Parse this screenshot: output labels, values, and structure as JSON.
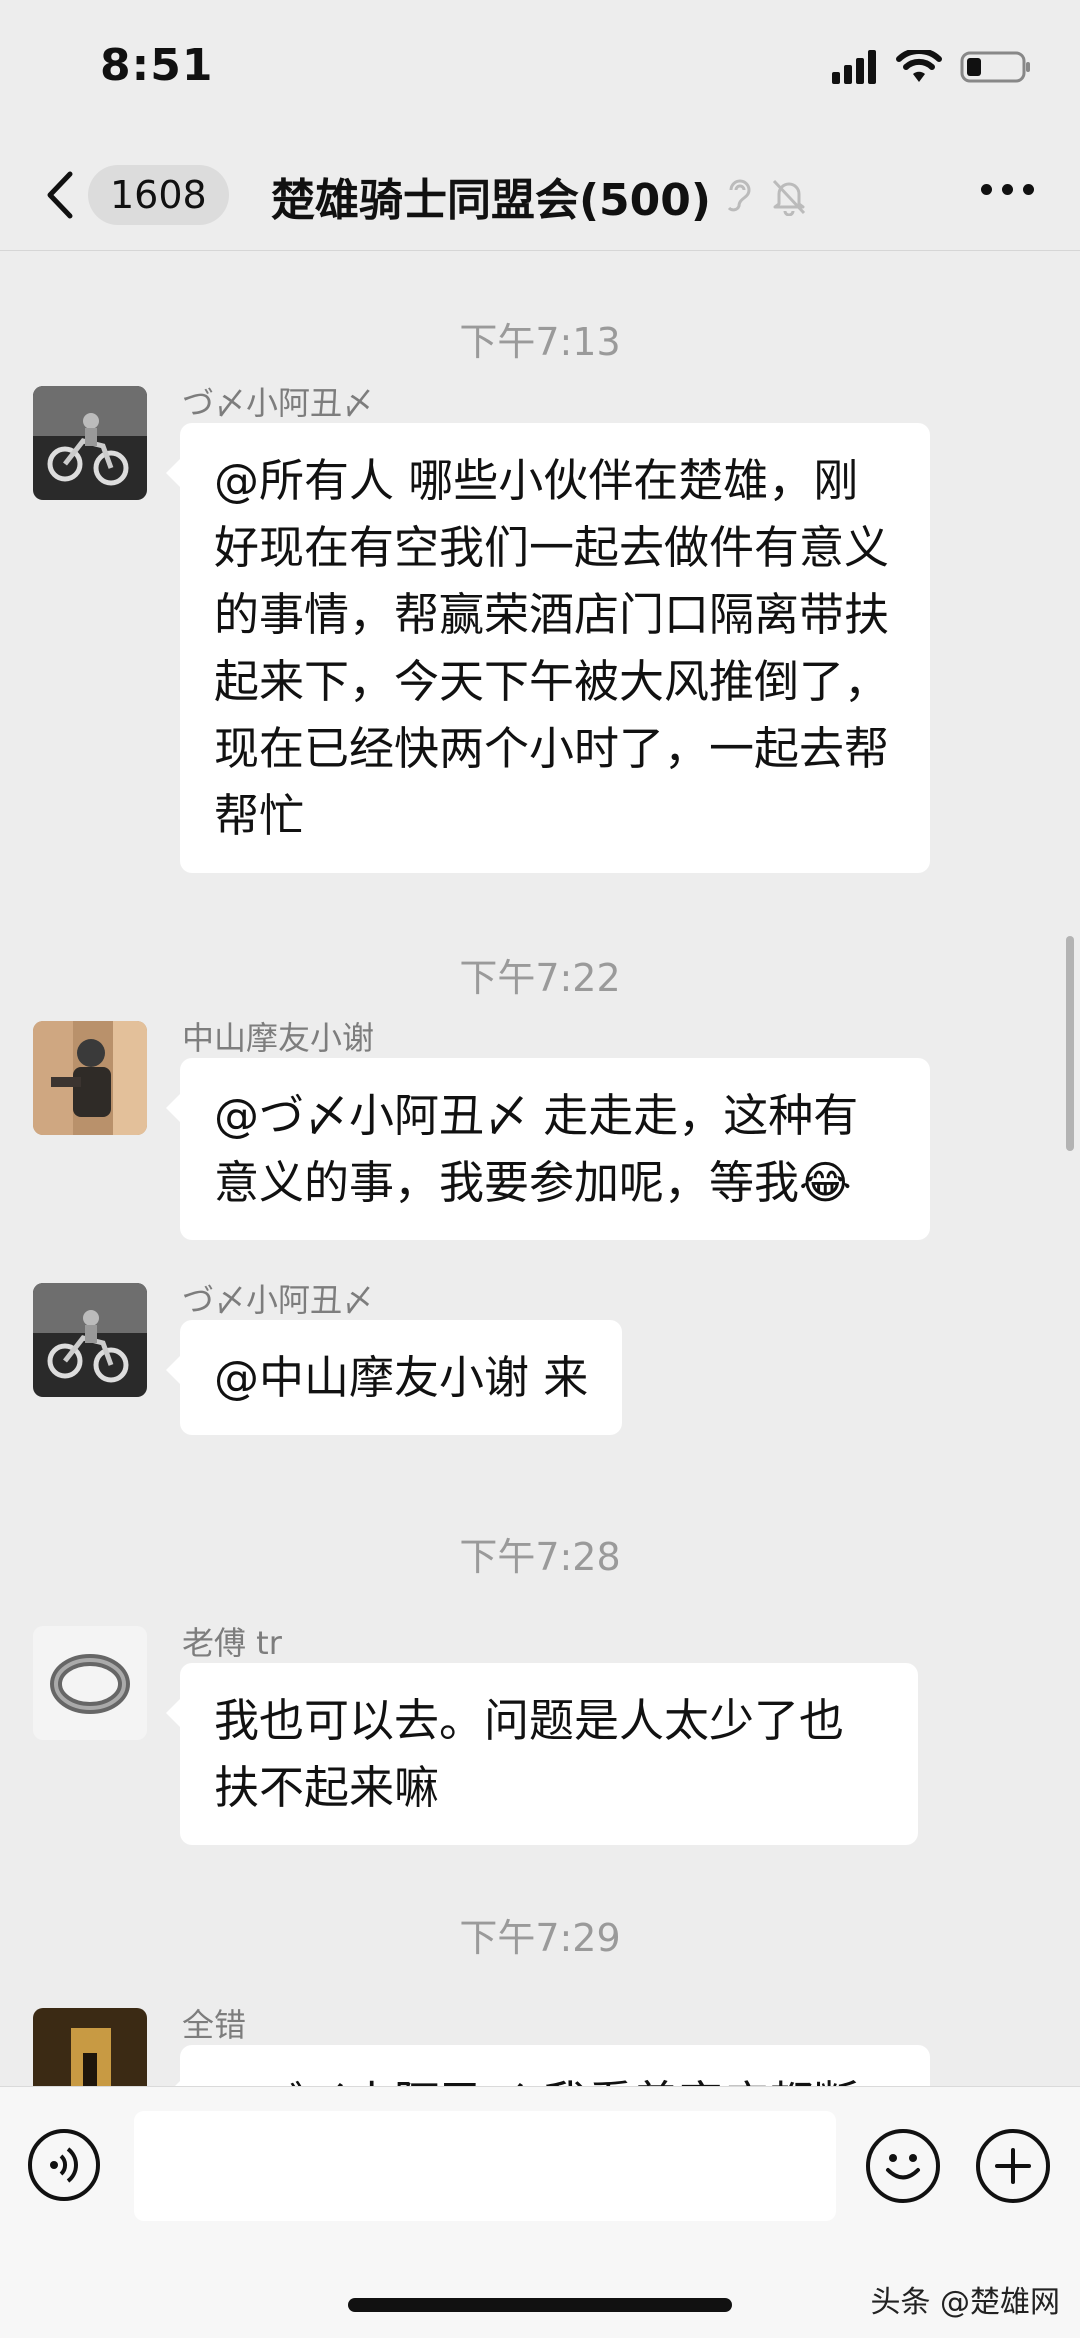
{
  "status": {
    "time": "8:51"
  },
  "nav": {
    "unread_count": "1608",
    "title": "楚雄骑士同盟会(500)"
  },
  "messages": [
    {
      "time": "下午7:13",
      "sender": "づ〆小阿丑〆",
      "text": "@所有人 哪些小伙伴在楚雄，刚好现在有空我们一起去做件有意义的事情，帮赢荣酒店门口隔离带扶起来下，今天下午被大风推倒了，现在已经快两个小时了，一起去帮帮忙"
    },
    {
      "time": "下午7:22",
      "sender": "中山摩友小谢",
      "text": "@づ〆小阿丑〆 走走走，这种有意义的事，我要参加呢，等我",
      "emoji": "😂"
    },
    {
      "sender": "づ〆小阿丑〆",
      "text": "@中山摩友小谢 来"
    },
    {
      "time": "下午7:28",
      "sender": "老傅 tr",
      "text": "我也可以去。问题是人太少了也扶不起来嘛"
    },
    {
      "time": "下午7:29",
      "sender": "全错",
      "text": "@づ〆小阿丑〆 我看着宾店都断"
    }
  ],
  "input": {
    "placeholder": ""
  },
  "watermark": "头条 @楚雄网",
  "colors": {
    "background": "#EDEDED",
    "bubble": "#FFFFFF",
    "timestamp": "#9A9A9A",
    "sender": "#7D7D7D"
  }
}
